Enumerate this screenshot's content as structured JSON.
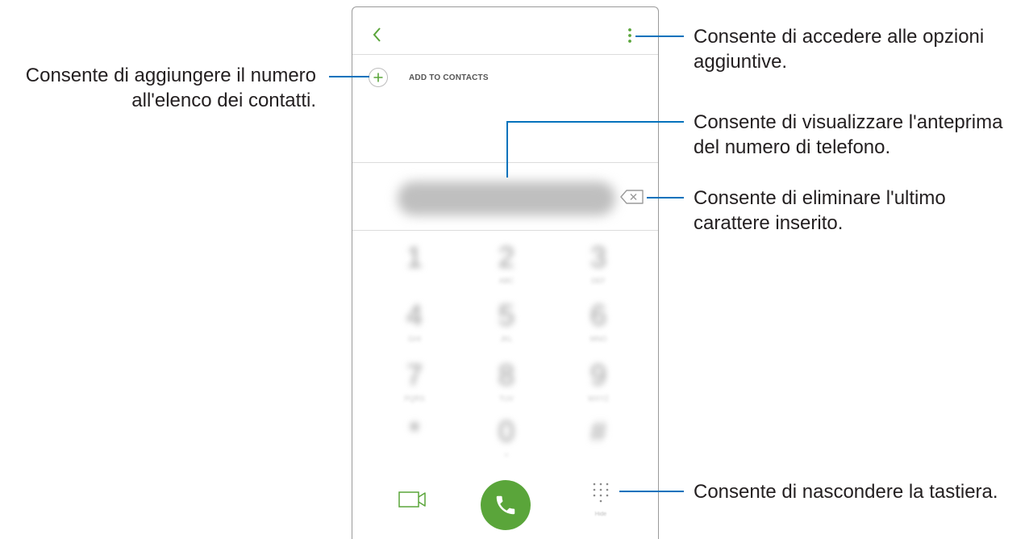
{
  "dialer": {
    "add_to_contacts_label": "ADD TO CONTACTS",
    "number_preview": "0000000000",
    "keys": [
      {
        "digit": "1",
        "letters": ""
      },
      {
        "digit": "2",
        "letters": "ABC"
      },
      {
        "digit": "3",
        "letters": "DEF"
      },
      {
        "digit": "4",
        "letters": "GHI"
      },
      {
        "digit": "5",
        "letters": "JKL"
      },
      {
        "digit": "6",
        "letters": "MNO"
      },
      {
        "digit": "7",
        "letters": "PQRS"
      },
      {
        "digit": "8",
        "letters": "TUV"
      },
      {
        "digit": "9",
        "letters": "WXYZ"
      },
      {
        "digit": "*",
        "letters": ""
      },
      {
        "digit": "0",
        "letters": "+"
      },
      {
        "digit": "#",
        "letters": ""
      }
    ],
    "keypad_toggle_label": "Hide",
    "accent_color": "#5aa53a",
    "icons": [
      "chevron-left-icon",
      "more-vertical-icon",
      "plus-icon",
      "backspace-icon",
      "video-call-icon",
      "phone-icon",
      "dialpad-icon"
    ]
  },
  "annotations": {
    "add_contact": [
      "Consente di aggiungere il numero",
      "all'elenco dei contatti."
    ],
    "more_options": [
      "Consente di accedere alle opzioni",
      "aggiuntive."
    ],
    "preview_number": [
      "Consente di visualizzare l'anteprima",
      "del numero di telefono."
    ],
    "delete_char": [
      "Consente di eliminare l'ultimo",
      "carattere inserito."
    ],
    "hide_keypad": [
      "Consente di nascondere la tastiera."
    ],
    "leader_color": "#0072bc"
  }
}
